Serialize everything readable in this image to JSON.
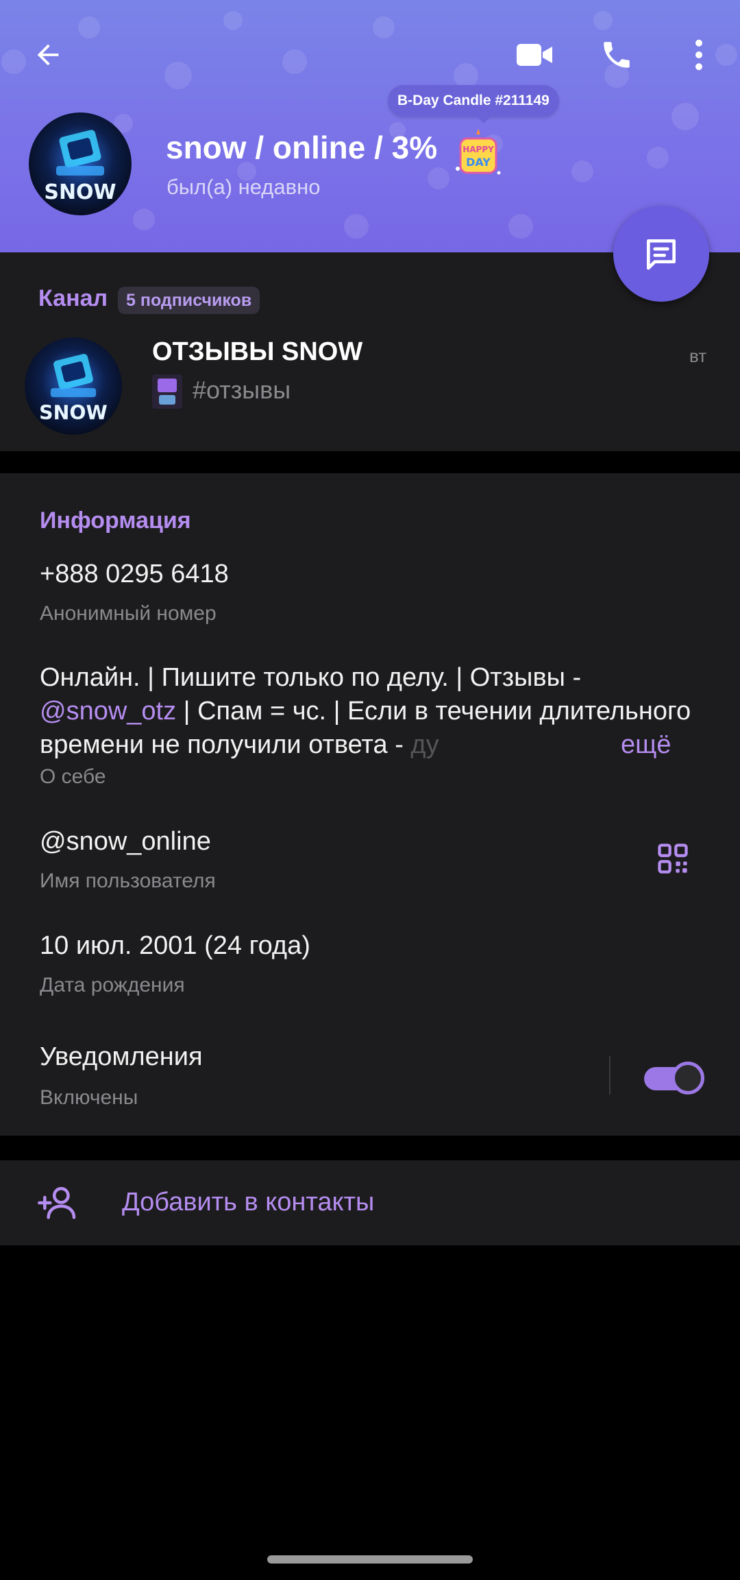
{
  "header": {
    "name": "snow / online / 3%",
    "status": "был(а) недавно",
    "badge": "B-Day Candle #211149",
    "avatar_text": "SNOW",
    "bday_emoji_text": "HAPPY DAY",
    "background_color": "#7b74e8",
    "icons": [
      "back-arrow-icon",
      "video-camera-icon",
      "phone-icon",
      "more-vertical-icon"
    ]
  },
  "channel": {
    "label": "Канал",
    "subscribers": "5 подписчиков",
    "title": "ОТЗЫВЫ SNOW",
    "preview": "#отзывы",
    "time": "вт"
  },
  "info": {
    "title": "Информация",
    "phone": "+888 0295 6418",
    "phone_label": "Анонимный номер",
    "bio_part1": "Онлайн. | Пишите только по делу. | Отзывы -",
    "bio_mention": "@snow_otz",
    "bio_part2": " | Спам = чс. | Если в течении длительного времени не получили ответа - ",
    "bio_fade": "ду",
    "bio_more": "ещё",
    "bio_label": "О себе",
    "username": "@snow_online",
    "username_label": "Имя пользователя",
    "birthday": "10 июл. 2001 (24 года)",
    "birthday_label": "Дата рождения",
    "notifications": "Уведомления",
    "notifications_state": "Включены",
    "notifications_enabled": true
  },
  "actions": {
    "add_contact": "Добавить в контакты"
  },
  "colors": {
    "accent": "#b58df0",
    "section_bg": "#1c1c1e",
    "fab": "#6a5de0"
  }
}
